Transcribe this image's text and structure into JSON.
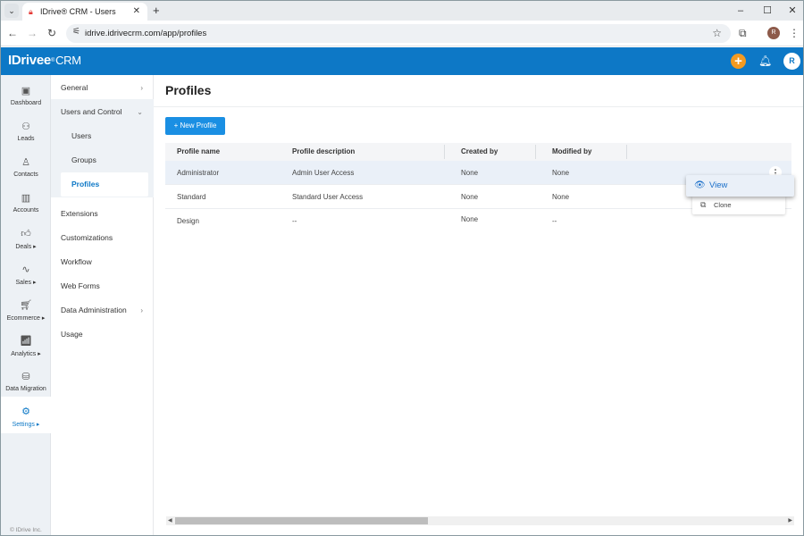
{
  "browser": {
    "tab_title": "IDrive® CRM - Users",
    "tab_list_icon": "chevron-down-icon",
    "url": "idrive.idrivecrm.com/app/profiles",
    "profile_initial": "R",
    "controls": {
      "minimize": "–",
      "maximize": "☐",
      "close": "✕"
    }
  },
  "app": {
    "logo_brand": "IDrive",
    "logo_e": "e",
    "logo_product": "CRM",
    "avatar_initial": "R",
    "accent_color": "#0d78c6",
    "add_button_color": "#f39a21"
  },
  "rail": {
    "items": [
      {
        "label": "Dashboard",
        "icon": "dashboard-icon"
      },
      {
        "label": "Leads",
        "icon": "leads-icon"
      },
      {
        "label": "Contacts",
        "icon": "contacts-icon"
      },
      {
        "label": "Accounts",
        "icon": "accounts-icon"
      },
      {
        "label": "Deals ▸",
        "icon": "deals-icon"
      },
      {
        "label": "Sales ▸",
        "icon": "sales-icon"
      },
      {
        "label": "Ecommerce ▸",
        "icon": "ecommerce-icon"
      },
      {
        "label": "Analytics ▸",
        "icon": "analytics-icon"
      },
      {
        "label": "Data Migration",
        "icon": "data-migration-icon"
      },
      {
        "label": "Settings ▸",
        "icon": "settings-icon",
        "active": true
      }
    ],
    "copyright": "© IDrive Inc."
  },
  "sidebar": {
    "general": "General",
    "users_and_control": "Users and Control",
    "sub_items": [
      "Users",
      "Groups",
      "Profiles"
    ],
    "active_sub": "Profiles",
    "items": [
      "Extensions",
      "Customizations",
      "Workflow",
      "Web Forms",
      "Data Administration",
      "Usage"
    ]
  },
  "main": {
    "title": "Profiles",
    "new_button": "New Profile",
    "columns": [
      "Profile name",
      "Profile description",
      "Created by",
      "Modified by"
    ],
    "rows": [
      {
        "name": "Administrator",
        "description": "Admin User Access",
        "created_by": "None",
        "modified_by": "None"
      },
      {
        "name": "Standard",
        "description": "Standard User Access",
        "created_by": "None",
        "modified_by": "None"
      },
      {
        "name": "Design",
        "description": "--",
        "created_by": "None",
        "modified_by": "--"
      }
    ],
    "context_menu": {
      "view": "View",
      "clone": "Clone"
    }
  }
}
